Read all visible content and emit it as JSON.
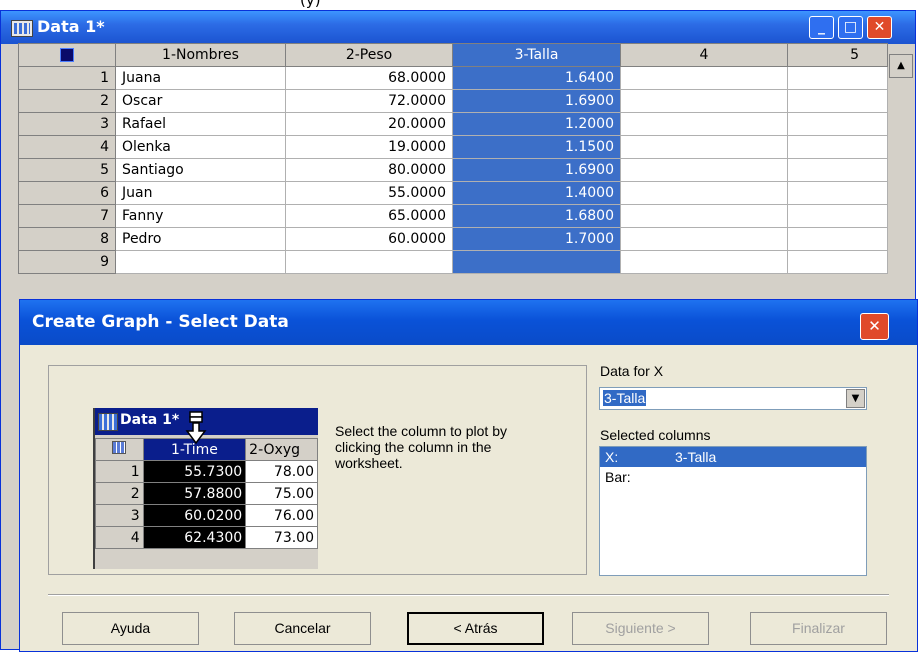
{
  "header_fragment": "(y)",
  "window": {
    "title": "Data 1*",
    "buttons": {
      "minimize": "_",
      "maximize": "□",
      "close": "✕"
    }
  },
  "worksheet": {
    "columns": [
      "1-Nombres",
      "2-Peso",
      "3-Talla",
      "4",
      "5"
    ],
    "selected_column": "3-Talla",
    "rows": [
      {
        "n": "1",
        "nombre": "Juana",
        "peso": "68.0000",
        "talla": "1.6400"
      },
      {
        "n": "2",
        "nombre": "Oscar",
        "peso": "72.0000",
        "talla": "1.6900"
      },
      {
        "n": "3",
        "nombre": "Rafael",
        "peso": "20.0000",
        "talla": "1.2000"
      },
      {
        "n": "4",
        "nombre": "Olenka",
        "peso": "19.0000",
        "talla": "1.1500"
      },
      {
        "n": "5",
        "nombre": "Santiago",
        "peso": "80.0000",
        "talla": "1.6900"
      },
      {
        "n": "6",
        "nombre": "Juan",
        "peso": "55.0000",
        "talla": "1.4000"
      },
      {
        "n": "7",
        "nombre": "Fanny",
        "peso": "65.0000",
        "talla": "1.6800"
      },
      {
        "n": "8",
        "nombre": "Pedro",
        "peso": "60.0000",
        "talla": "1.7000"
      },
      {
        "n": "9",
        "nombre": "",
        "peso": "",
        "talla": ""
      }
    ]
  },
  "dialog": {
    "title": "Create Graph - Select Data",
    "preview": {
      "window_title": "Data 1*",
      "columns": [
        "1-Time",
        "2-Oxyg"
      ],
      "rows": [
        {
          "n": "1",
          "a": "55.7300",
          "b": "78.00"
        },
        {
          "n": "2",
          "a": "57.8800",
          "b": "75.00"
        },
        {
          "n": "3",
          "a": "60.0200",
          "b": "76.00"
        },
        {
          "n": "4",
          "a": "62.4300",
          "b": "73.00"
        }
      ]
    },
    "instruction": "Select the column to plot by clicking the column in the worksheet.",
    "data_for_x_label": "Data for X",
    "data_for_x_value": "3-Talla",
    "selected_columns_label": "Selected columns",
    "selected_columns": [
      {
        "key": "X:",
        "value": "3-Talla"
      },
      {
        "key": "Bar:",
        "value": ""
      }
    ],
    "buttons": {
      "help": "Ayuda",
      "cancel": "Cancelar",
      "back": "< Atrás",
      "next": "Siguiente >",
      "finish": "Finalizar"
    }
  },
  "colors": {
    "selection": "#3c6fc8",
    "title_bar": "#1b53d0"
  }
}
